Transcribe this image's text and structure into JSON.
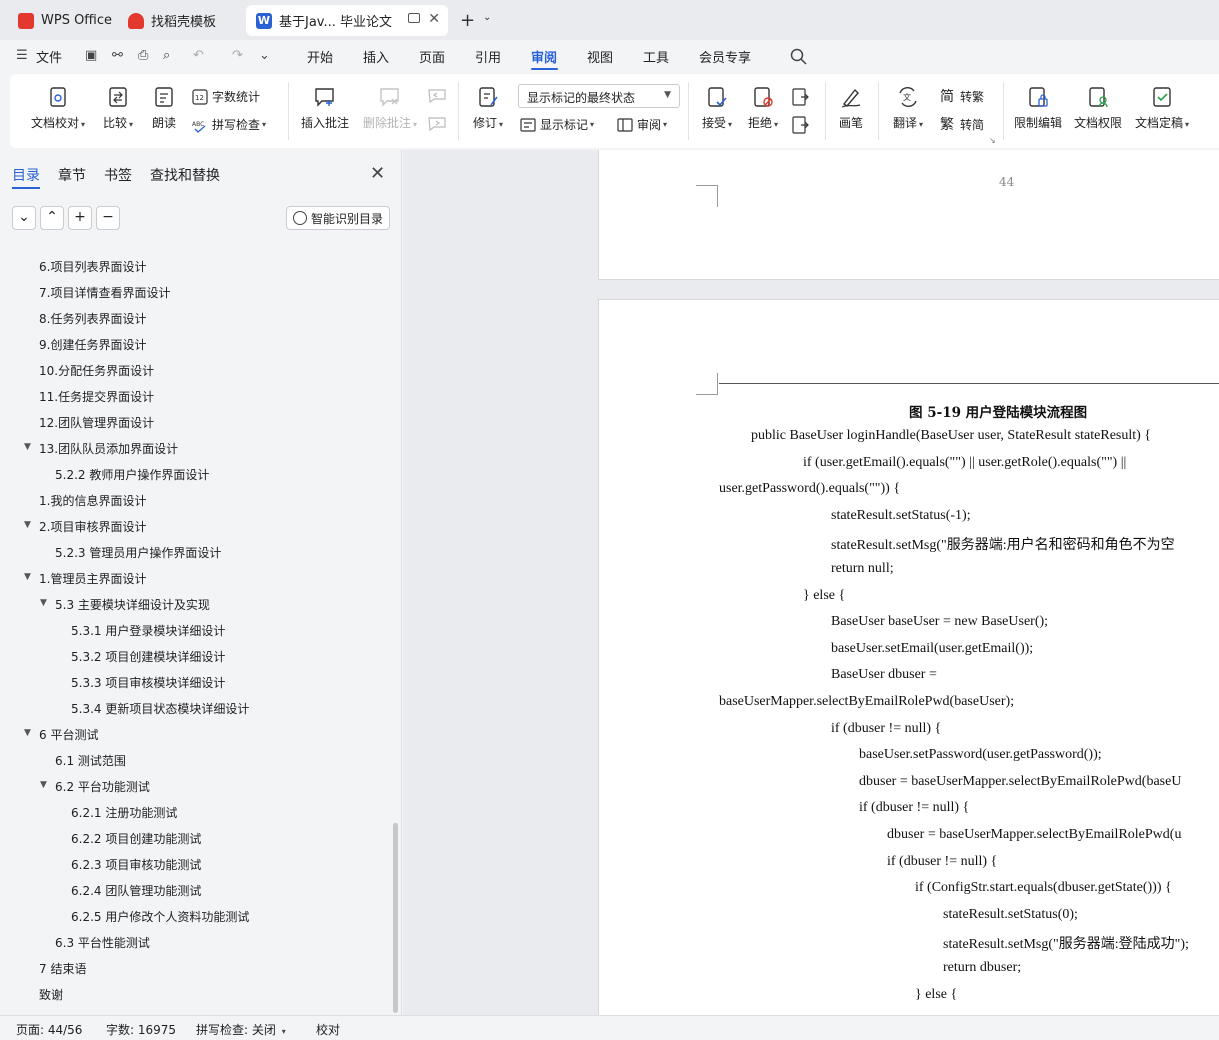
{
  "tabs": [
    {
      "label": "WPS Office",
      "color": "#e2382d"
    },
    {
      "label": "找稻壳模板",
      "color": "#e2382d"
    },
    {
      "label": "基于Jav... 毕业论文",
      "color": "#2a62d6"
    }
  ],
  "menu": {
    "file": "文件",
    "items": [
      "开始",
      "插入",
      "页面",
      "引用",
      "审阅",
      "视图",
      "工具",
      "会员专享"
    ],
    "active": "审阅"
  },
  "ribbon": {
    "doc_check": "文档校对",
    "compare": "比较",
    "read_aloud": "朗读",
    "word_count": "字数统计",
    "spell_check": "拼写检查",
    "insert_comment": "插入批注",
    "delete_comment": "删除批注",
    "revise": "修订",
    "markup_state": "显示标记的最终状态",
    "show_markup": "显示标记",
    "review": "审阅",
    "accept": "接受",
    "reject": "拒绝",
    "pen": "画笔",
    "translate": "翻译",
    "to_traditional": "转繁",
    "to_simplified": "转简",
    "restrict_edit": "限制编辑",
    "doc_permission": "文档权限",
    "doc_finalize": "文档定稿"
  },
  "sidebar": {
    "tabs": [
      "目录",
      "章节",
      "书签",
      "查找和替换"
    ],
    "smart_toc": "智能识别目录",
    "toc": [
      {
        "label": "6.项目列表界面设计",
        "level": 1,
        "caret": false
      },
      {
        "label": "7.项目详情查看界面设计",
        "level": 1,
        "caret": false
      },
      {
        "label": "8.任务列表界面设计",
        "level": 1,
        "caret": false
      },
      {
        "label": "9.创建任务界面设计",
        "level": 1,
        "caret": false
      },
      {
        "label": "10.分配任务界面设计",
        "level": 1,
        "caret": false
      },
      {
        "label": "11.任务提交界面设计",
        "level": 1,
        "caret": false
      },
      {
        "label": "12.团队管理界面设计",
        "level": 1,
        "caret": false
      },
      {
        "label": "13.团队队员添加界面设计",
        "level": 1,
        "caret": true
      },
      {
        "label": "5.2.2  教师用户操作界面设计",
        "level": 2,
        "caret": false
      },
      {
        "label": "1.我的信息界面设计",
        "level": 1,
        "caret": false
      },
      {
        "label": "2.项目审核界面设计",
        "level": 1,
        "caret": true
      },
      {
        "label": "5.2.3  管理员用户操作界面设计",
        "level": 2,
        "caret": false
      },
      {
        "label": "1.管理员主界面设计",
        "level": 1,
        "caret": true
      },
      {
        "label": "5.3  主要模块详细设计及实现",
        "level": 2,
        "caret": true
      },
      {
        "label": "5.3.1  用户登录模块详细设计",
        "level": 3,
        "caret": false
      },
      {
        "label": "5.3.2  项目创建模块详细设计",
        "level": 3,
        "caret": false
      },
      {
        "label": "5.3.3  项目审核模块详细设计",
        "level": 3,
        "caret": false
      },
      {
        "label": "5.3.4  更新项目状态模块详细设计",
        "level": 3,
        "caret": false
      },
      {
        "label": "6  平台测试",
        "level": 1,
        "caret": true
      },
      {
        "label": "6.1  测试范围",
        "level": 2,
        "caret": false
      },
      {
        "label": "6.2  平台功能测试",
        "level": 2,
        "caret": true
      },
      {
        "label": "6.2.1  注册功能测试",
        "level": 3,
        "caret": false
      },
      {
        "label": "6.2.2  项目创建功能测试",
        "level": 3,
        "caret": false
      },
      {
        "label": "6.2.3  项目审核功能测试",
        "level": 3,
        "caret": false
      },
      {
        "label": "6.2.4  团队管理功能测试",
        "level": 3,
        "caret": false
      },
      {
        "label": "6.2.5  用户修改个人资料功能测试",
        "level": 3,
        "caret": false
      },
      {
        "label": "6.3  平台性能测试",
        "level": 2,
        "caret": false
      },
      {
        "label": "7  结束语",
        "level": 1,
        "caret": false
      },
      {
        "label": "致谢",
        "level": 1,
        "caret": false
      }
    ]
  },
  "document": {
    "page_number": "44",
    "figure_title": "图 5-19 用户登陆模块流程图",
    "code_lines": [
      {
        "text": "public BaseUser loginHandle(BaseUser user, StateResult stateResult) {",
        "indent": 1
      },
      {
        "text": "if (user.getEmail().equals(\"\") || user.getRole().equals(\"\") ||",
        "indent": 3
      },
      {
        "text": "user.getPassword().equals(\"\")) {",
        "indent": 0
      },
      {
        "text": "stateResult.setStatus(-1);",
        "indent": 4
      },
      {
        "text": "stateResult.setMsg(\"服务器端:用户名和密码和角色不为空",
        "indent": 4
      },
      {
        "text": "return null;",
        "indent": 4
      },
      {
        "text": "} else {",
        "indent": 3
      },
      {
        "text": "BaseUser baseUser = new BaseUser();",
        "indent": 4
      },
      {
        "text": "baseUser.setEmail(user.getEmail());",
        "indent": 4
      },
      {
        "text": "BaseUser dbuser =",
        "indent": 4
      },
      {
        "text": "baseUserMapper.selectByEmailRolePwd(baseUser);",
        "indent": 0
      },
      {
        "text": "if (dbuser != null) {",
        "indent": 4
      },
      {
        "text": "baseUser.setPassword(user.getPassword());",
        "indent": 5
      },
      {
        "text": "dbuser = baseUserMapper.selectByEmailRolePwd(baseU",
        "indent": 5
      },
      {
        "text": "if (dbuser != null) {",
        "indent": 5
      },
      {
        "text": "dbuser = baseUserMapper.selectByEmailRolePwd(u",
        "indent": 6
      },
      {
        "text": "if (dbuser != null) {",
        "indent": 6
      },
      {
        "text": "if (ConfigStr.start.equals(dbuser.getState())) {",
        "indent": 7
      },
      {
        "text": "stateResult.setStatus(0);",
        "indent": 8
      },
      {
        "text": "stateResult.setMsg(\"服务器端:登陆成功\");",
        "indent": 8
      },
      {
        "text": "return dbuser;",
        "indent": 8
      },
      {
        "text": "} else {",
        "indent": 7
      }
    ]
  },
  "statusbar": {
    "page": "页面: 44/56",
    "words": "字数: 16975",
    "spell": "拼写检查: 关闭",
    "proof": "校对"
  },
  "colors": {
    "accent": "#2a62d6",
    "wps_red": "#e2382d"
  }
}
